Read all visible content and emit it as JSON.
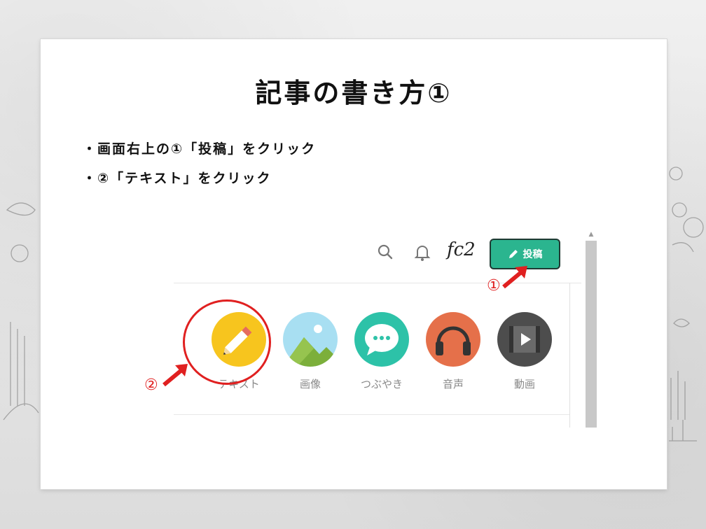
{
  "slide": {
    "title": "記事の書き方①",
    "bullets": [
      "・画面右上の①「投稿」をクリック",
      "・②「テキスト」をクリック"
    ]
  },
  "screenshot": {
    "toolbar": {
      "icons": [
        "search-icon",
        "bell-icon",
        "fc2-logo-icon"
      ],
      "logo_text": "fc2",
      "post_button_label": "投稿"
    },
    "post_types": [
      {
        "label": "テキスト",
        "icon": "pencil-icon",
        "color": "#f7c51e"
      },
      {
        "label": "画像",
        "icon": "image-icon",
        "color": "#a8dff2"
      },
      {
        "label": "つぶやき",
        "icon": "speech-bubble-icon",
        "color": "#2dc2a8"
      },
      {
        "label": "音声",
        "icon": "headphones-icon",
        "color": "#e5704a"
      },
      {
        "label": "動画",
        "icon": "film-icon",
        "color": "#4d4d4d"
      }
    ]
  },
  "annotations": {
    "marker_1": "①",
    "marker_2": "②",
    "accent_color": "#e02020"
  }
}
